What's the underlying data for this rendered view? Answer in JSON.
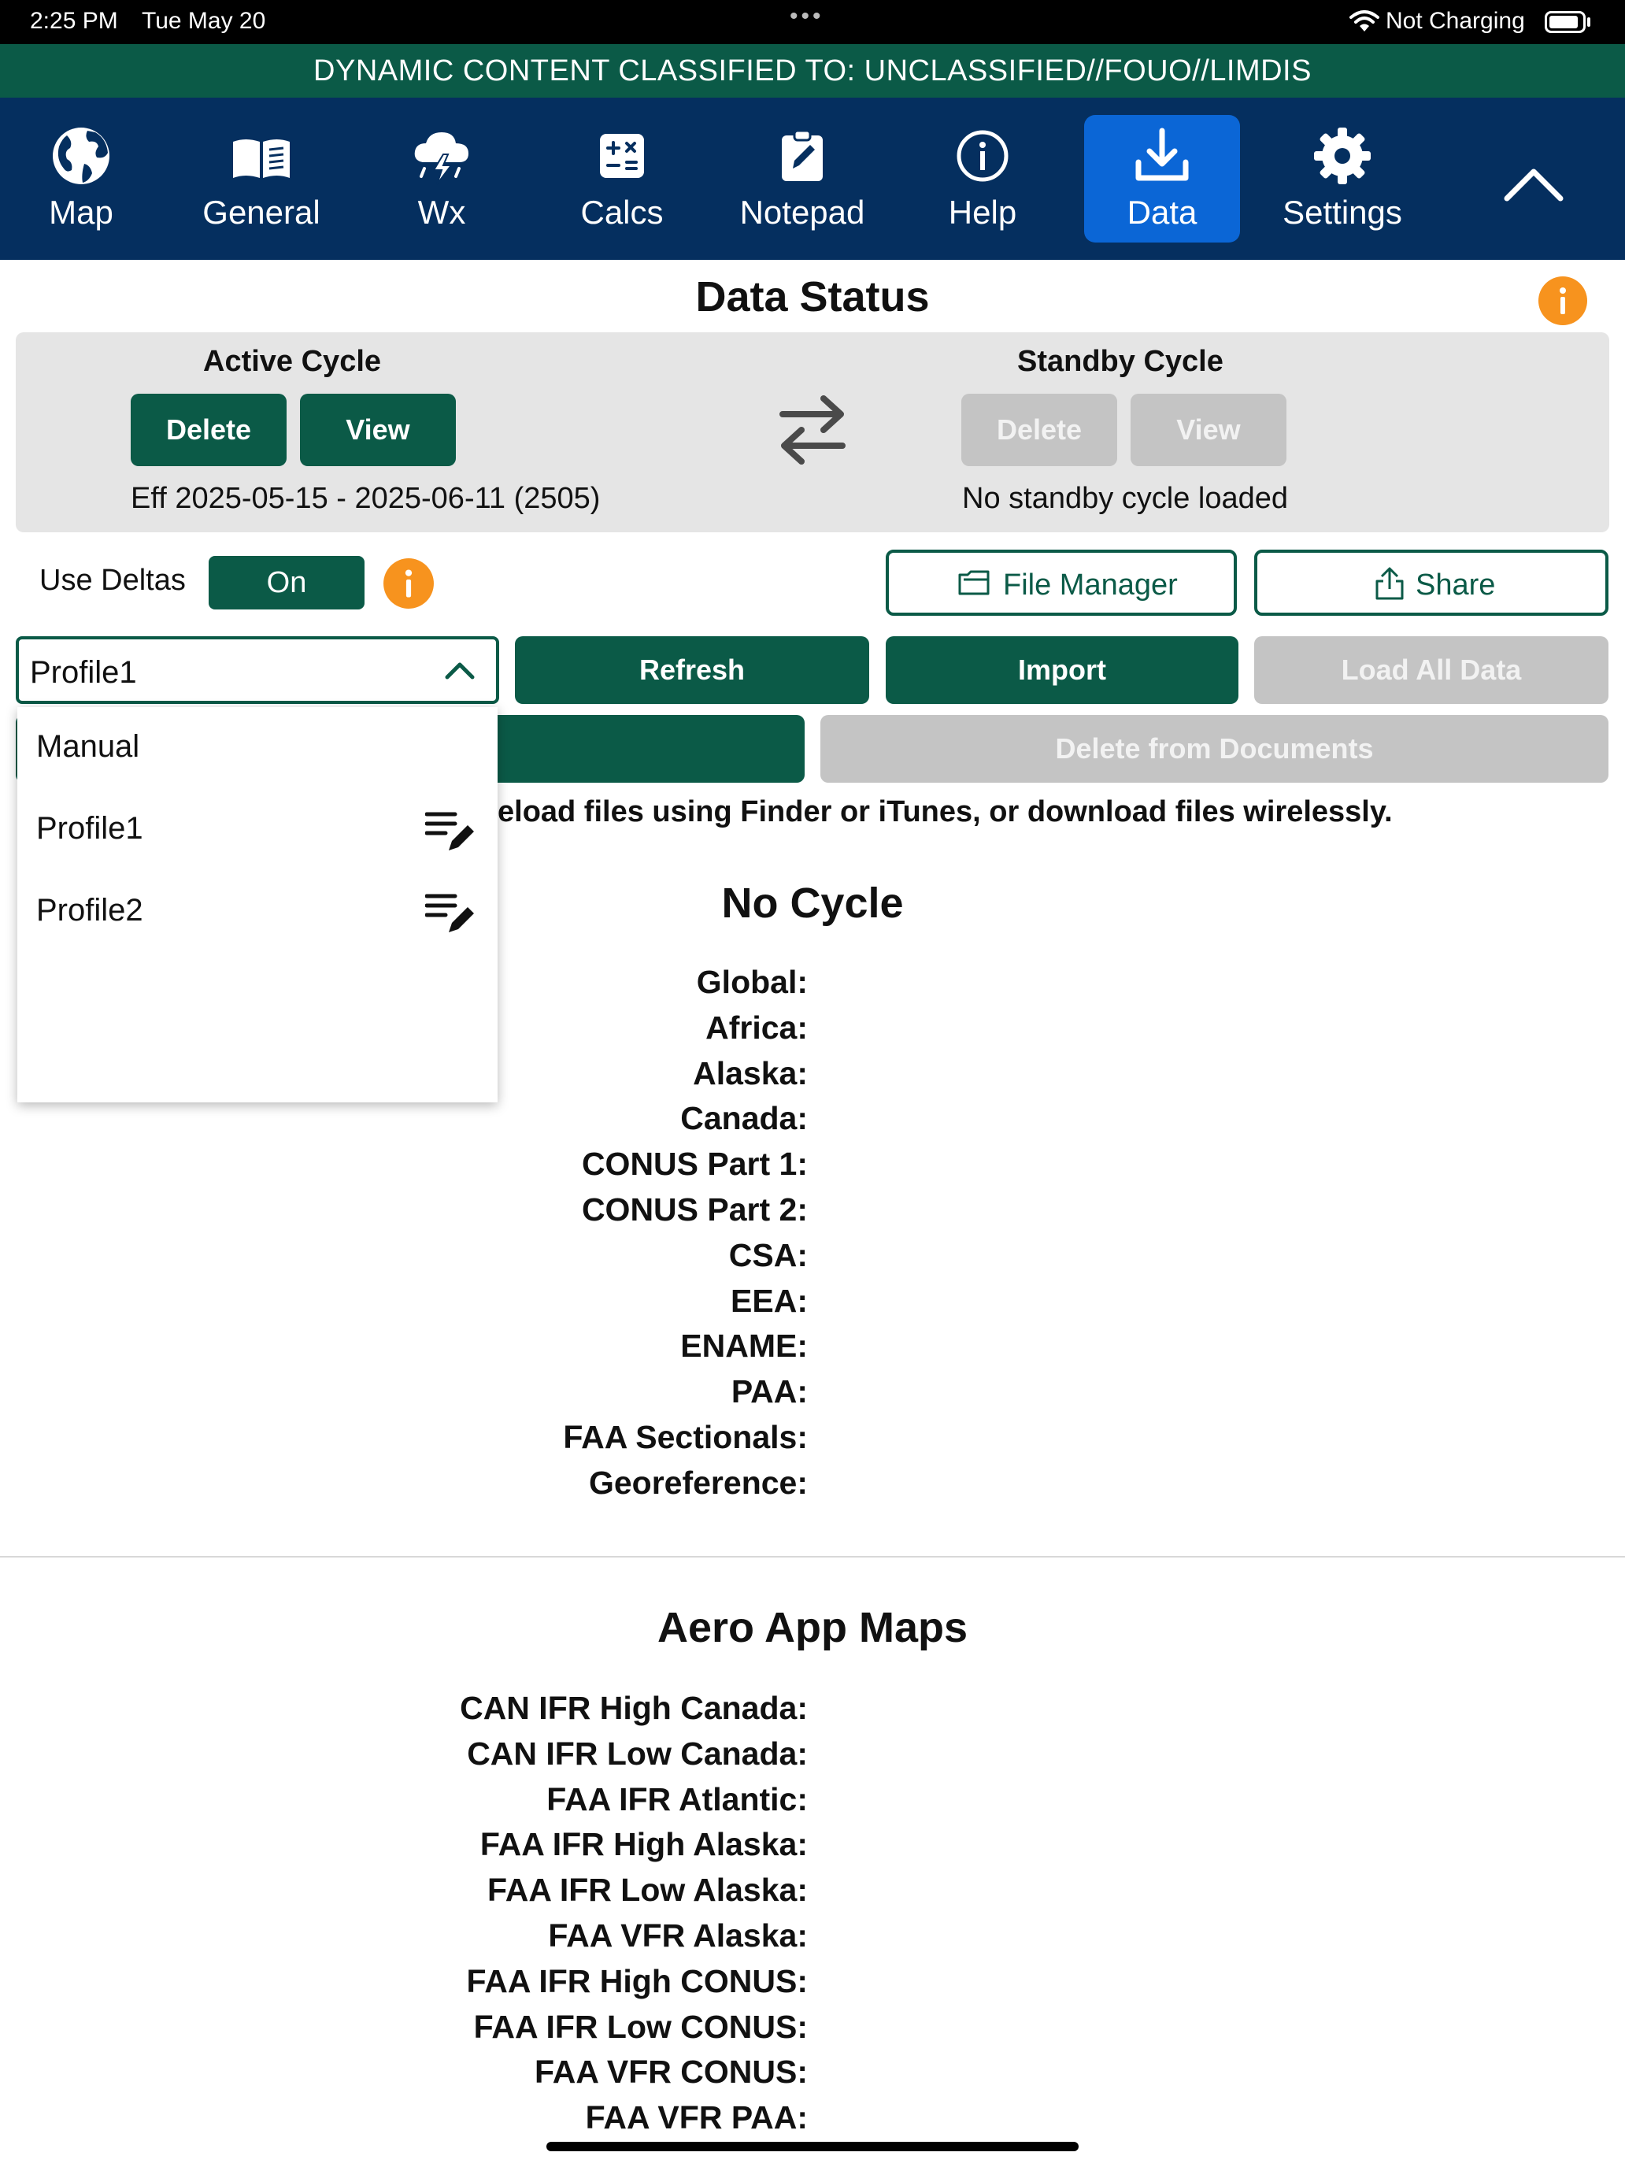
{
  "status_bar": {
    "time": "2:25 PM",
    "date": "Tue May 20",
    "dots": "•••",
    "charging": "Not Charging"
  },
  "classification": "DYNAMIC CONTENT CLASSIFIED TO: UNCLASSIFIED//FOUO//LIMDIS",
  "nav": {
    "items": [
      {
        "label": "Map",
        "icon": "globe-icon"
      },
      {
        "label": "General",
        "icon": "book-icon"
      },
      {
        "label": "Wx",
        "icon": "storm-cloud-icon"
      },
      {
        "label": "Calcs",
        "icon": "calculator-icon"
      },
      {
        "label": "Notepad",
        "icon": "notepad-icon"
      },
      {
        "label": "Help",
        "icon": "info-icon"
      },
      {
        "label": "Data",
        "icon": "download-icon"
      },
      {
        "label": "Settings",
        "icon": "gear-icon"
      }
    ],
    "active": "Data"
  },
  "page_title": "Data Status",
  "active_cycle": {
    "heading": "Active Cycle",
    "delete_label": "Delete",
    "view_label": "View",
    "effective": "Eff 2025-05-15 - 2025-06-11 (2505)"
  },
  "standby_cycle": {
    "heading": "Standby Cycle",
    "delete_label": "Delete",
    "view_label": "View",
    "status": "No standby cycle loaded"
  },
  "deltas": {
    "label": "Use Deltas",
    "toggle": "On"
  },
  "file_manager_label": "File Manager",
  "share_label": "Share",
  "profile_select": {
    "value": "Profile1",
    "options": [
      {
        "label": "Manual"
      },
      {
        "label": "Profile1"
      },
      {
        "label": "Profile2"
      }
    ]
  },
  "actions": {
    "refresh": "Refresh",
    "import": "Import",
    "load_all": "Load All Data",
    "delete_docs": "Delete from Documents"
  },
  "hint_text": "eload files using Finder or iTunes, or download files wirelessly.",
  "no_cycle": {
    "heading": "No Cycle",
    "rows": [
      "Global:",
      "Africa:",
      "Alaska:",
      "Canada:",
      "CONUS Part 1:",
      "CONUS Part 2:",
      "CSA:",
      "EEA:",
      "ENAME:",
      "PAA:",
      "FAA Sectionals:",
      "Georeference:"
    ]
  },
  "aero_maps": {
    "heading": "Aero App Maps",
    "rows": [
      "CAN IFR High Canada:",
      "CAN IFR Low Canada:",
      "FAA IFR Atlantic:",
      "FAA IFR High Alaska:",
      "FAA IFR Low Alaska:",
      "FAA VFR Alaska:",
      "FAA IFR High CONUS:",
      "FAA IFR Low CONUS:",
      "FAA VFR CONUS:",
      "FAA VFR PAA:"
    ]
  },
  "colors": {
    "brand_green": "#0b5a47",
    "nav_blue": "#052f5f",
    "active_blue": "#0b66d6",
    "info_orange": "#f7931e",
    "disabled_gray": "#c4c4c4"
  }
}
